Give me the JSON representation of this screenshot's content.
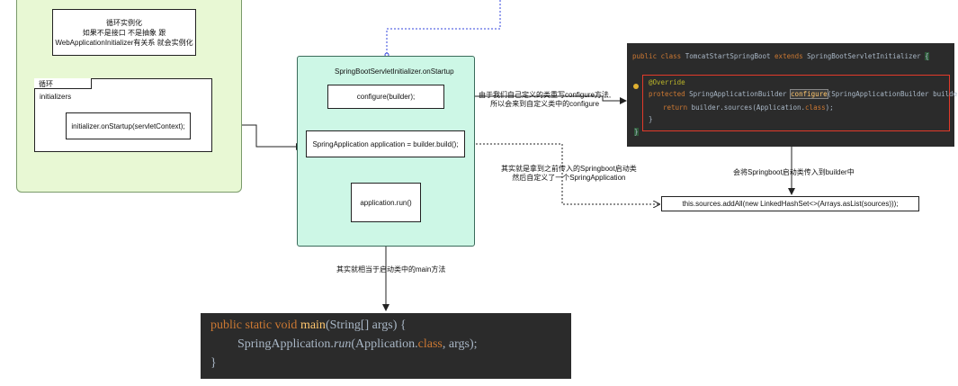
{
  "loop_outer": {
    "note_lines": [
      "循环实例化",
      "如果不是接口 不是抽象 跟",
      "WebApplicationInitializer有关系  就会实例化"
    ]
  },
  "loop_frame": {
    "tab_label": "循环",
    "sub_label": "initializers",
    "call_box": "initializer.onStartup(servletContext);"
  },
  "startup": {
    "title": "SpringBootServletInitializer.onStartup",
    "configure_box": "configure(builder);",
    "build_box": "SpringApplication application = builder.build();",
    "run_box": "application.run()"
  },
  "notes": {
    "configure_note": [
      "由于我们自己定义的类重写configure方法,",
      "所以会来到自定义类中的configure"
    ],
    "builder_note": [
      "其实就是拿到之前传入的Springboot启动类",
      "然后自定义了一个SpringApplication"
    ],
    "sources_note": "会将Springboot启动类传入到builder中",
    "main_note": "其实就相当于启动类中的main方法"
  },
  "sources_box": "this.sources.addAll(new LinkedHashSet<>(Arrays.asList(sources)));",
  "code_right": {
    "line1": {
      "kw1": "public ",
      "kw2": "class ",
      "name": "TomcatStartSpringBoot ",
      "kw3": "extends ",
      "parent": "SpringBootServletInitializer ",
      "brace": "{"
    },
    "annotation": "@Override",
    "line3": {
      "kw": "protected ",
      "type": "SpringApplicationBuilder ",
      "method": "configure",
      "params": "(SpringApplicationBuilder builder) {"
    },
    "line4": {
      "kw": "return ",
      "body": "builder.sources(Application.",
      "kw2": "class",
      "end": ");"
    },
    "close1": "}",
    "close2": "}"
  },
  "code_main": {
    "line1": {
      "kw": "public static void ",
      "name": "main",
      "params": "(String[] args) {"
    },
    "line2": {
      "pre": "SpringApplication.",
      "run": "run",
      "mid": "(Application.",
      "kw": "class",
      "end": ", args);"
    },
    "close": "}"
  },
  "colors": {
    "green_panel": "#e8f8d4",
    "startup_panel": "#cdf7e6",
    "code_bg": "#2b2b2b",
    "keyword": "#cc7832",
    "annotation": "#bbb529",
    "highlight_border": "#e23a2a"
  }
}
